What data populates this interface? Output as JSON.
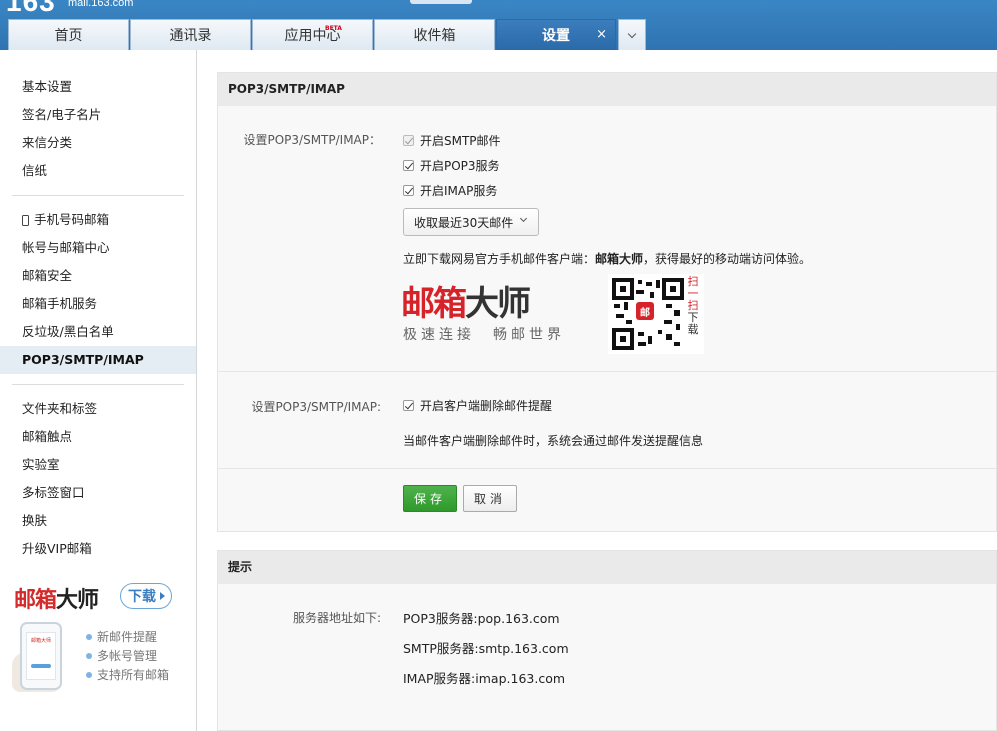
{
  "header": {
    "logo_number": "163",
    "logo_domain": "mail.163.com",
    "tabs": [
      {
        "label": "首页"
      },
      {
        "label": "通讯录"
      },
      {
        "label": "应用中心",
        "badge": "BETA"
      },
      {
        "label": "收件箱"
      },
      {
        "label": "设置",
        "close": "×"
      }
    ]
  },
  "sidebar": {
    "group1": [
      "基本设置",
      "签名/电子名片",
      "来信分类",
      "信纸"
    ],
    "group2": [
      "手机号码邮箱",
      "帐号与邮箱中心",
      "邮箱安全",
      "邮箱手机服务",
      "反垃圾/黑白名单",
      "POP3/SMTP/IMAP"
    ],
    "group3": [
      "文件夹和标签",
      "邮箱触点",
      "实验室",
      "多标签窗口",
      "换肤",
      "升级VIP邮箱"
    ],
    "promo": {
      "logo_red": "邮箱",
      "logo_dark": "大师",
      "download": "下载",
      "phone_text": "邮箱大师",
      "features": [
        "新邮件提醒",
        "多帐号管理",
        "支持所有邮箱"
      ]
    }
  },
  "pop3": {
    "title": "POP3/SMTP/IMAP",
    "section1_label": "设置POP3/SMTP/IMAP：",
    "options": [
      {
        "label": "开启SMTP邮件",
        "checked": true,
        "disabled": true
      },
      {
        "label": "开启POP3服务",
        "checked": true
      },
      {
        "label": "开启IMAP服务",
        "checked": true
      }
    ],
    "fetch_select": "收取最近30天邮件",
    "tip_prefix": "立即下载网易官方手机邮件客户端：",
    "tip_bold": "邮箱大师",
    "tip_suffix": "，获得最好的移动端访问体验。",
    "brand_red": "邮箱",
    "brand_dark": "大师",
    "slogan": "极速连接　畅邮世界",
    "qr_mark": "邮",
    "qr_side_red": "扫一扫",
    "qr_side_dark": "下载",
    "section2_label": "设置POP3/SMTP/IMAP:",
    "delete_notice_label": "开启客户端删除邮件提醒",
    "delete_notice_desc": "当邮件客户端删除邮件时，系统会通过邮件发送提醒信息",
    "save": "保存",
    "cancel": "取消"
  },
  "hint": {
    "title": "提示",
    "server_label": "服务器地址如下:",
    "servers": [
      "POP3服务器:pop.163.com",
      "SMTP服务器:smtp.163.com",
      "IMAP服务器:imap.163.com"
    ]
  },
  "colors": {
    "header_blue": "#2f73b2",
    "brand_red": "#d6232a",
    "save_green": "#2f9a2c"
  }
}
